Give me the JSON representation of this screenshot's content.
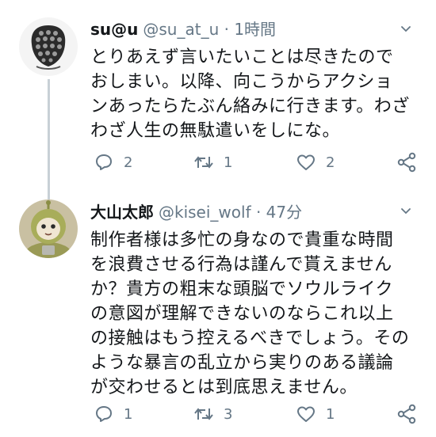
{
  "tweets": [
    {
      "name": "su@u",
      "meta": "@su_at_u · 1時間",
      "text": "とりあえず言いたいことは尽きたので\nおしまい。以降、向こうからアクショ\nンあったらたぶん絡みに行きます。わざ\nわざ人生の無駄遣いをしにな。",
      "reply_count": "2",
      "retweet_count": "1",
      "like_count": "2"
    },
    {
      "name": "大山太郎",
      "meta": "@kisei_wolf · 47分",
      "text": "制作者様は多忙の身なので貴重な時間\nを浪費させる行為は謹んで貰えません\nか？貴方の粗末な頭脳でソウルライク\nの意図が理解できないのならこれ以上\nの接触はもう控えるべきでしょう。その\nような暴言の乱立から実りのある議論\nが交わせるとは到底思えません。",
      "reply_count": "1",
      "retweet_count": "3",
      "like_count": "1"
    }
  ],
  "colors": {
    "text": "#14171a",
    "secondary": "#657786",
    "thread_line": "#c8d0d6"
  },
  "icons": [
    "reply-icon",
    "retweet-icon",
    "like-icon",
    "share-icon",
    "chevron-down-icon"
  ]
}
